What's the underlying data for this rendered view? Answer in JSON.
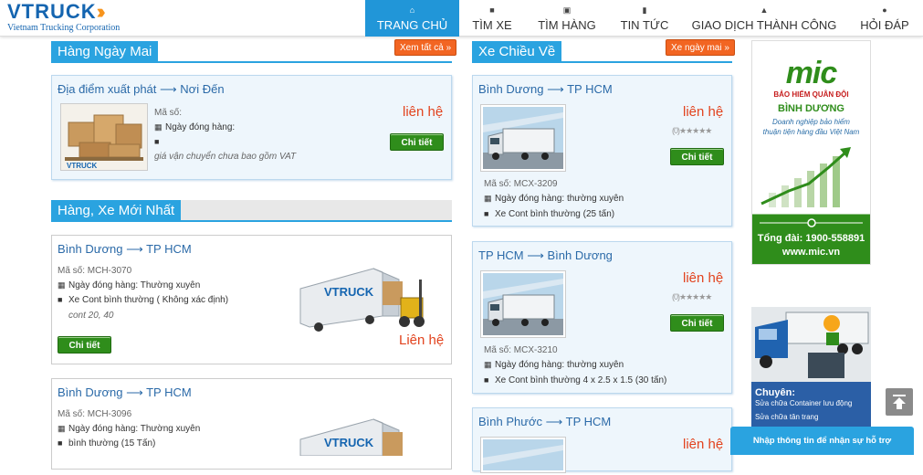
{
  "brand": {
    "word": "VTRUCK",
    "subtitle": "Vietnam Trucking Corporation"
  },
  "nav": [
    {
      "label": "TRANG CHỦ",
      "icon": "home-icon",
      "active": true
    },
    {
      "label": "TÌM XE",
      "icon": "truck-icon"
    },
    {
      "label": "TÌM HÀNG",
      "icon": "cubes-icon"
    },
    {
      "label": "TIN TỨC",
      "icon": "book-icon"
    },
    {
      "label": "GIAO DỊCH THÀNH CÔNG",
      "icon": "thumbs-up-icon"
    },
    {
      "label": "HỎI ĐÁP",
      "icon": "comments-icon"
    }
  ],
  "sections": {
    "tomorrow": {
      "title": "Hàng Ngày Mai",
      "more": "Xem tất cả »"
    },
    "return": {
      "title": "Xe Chiều Về",
      "more": "Xe ngày mai »"
    },
    "latest": {
      "title": "Hàng, Xe Mới Nhất"
    }
  },
  "tomorrow_card": {
    "route_from": "Địa điểm xuất phát",
    "route_to": "Nơi Đến",
    "code_label": "Mã số:",
    "date_label": "Ngày đóng hàng:",
    "note": "giá vận chuyển chưa bao gồm VAT",
    "price": "liên hệ",
    "button": "Chi tiết"
  },
  "latest_cards": [
    {
      "from": "Bình Dương",
      "to": "TP HCM",
      "code": "Mã số: MCH-3070",
      "date": "Ngày đóng hàng: Thường xuyên",
      "vehicle": "Xe Cont bình thường ( Không xác định)",
      "note": "cont 20, 40",
      "price": "Liên hệ",
      "button": "Chi tiết"
    },
    {
      "from": "Bình Dương",
      "to": "TP HCM",
      "code": "Mã số: MCH-3096",
      "date": "Ngày đóng hàng: Thường xuyên",
      "vehicle": "bình thường (15 Tấn)"
    }
  ],
  "return_cards": [
    {
      "from": "Bình Dương",
      "to": "TP HCM",
      "price": "liên hệ",
      "rating": "(0)★★★★★",
      "button": "Chi tiết",
      "code": "Mã số: MCX-3209",
      "date": "Ngày đóng hàng: thường xuyên",
      "vehicle": "Xe Cont bình thường (25 tấn)"
    },
    {
      "from": "TP HCM",
      "to": "Bình Dương",
      "price": "liên hệ",
      "rating": "(0)★★★★★",
      "button": "Chi tiết",
      "code": "Mã số: MCX-3210",
      "date": "Ngày đóng hàng: thường xuyên",
      "vehicle": "Xe Cont bình thường 4 x 2.5 x 1.5 (30 tấn)"
    },
    {
      "from": "Bình Phước",
      "to": "TP HCM",
      "price": "liên hệ"
    }
  ],
  "ads": {
    "mic": {
      "logo": "mic",
      "line1": "BẢO HIỂM QUÂN ĐỘI",
      "line2": "BÌNH DƯƠNG",
      "line3": "Doanh nghiệp bảo hiểm",
      "line4": "thuận tiện hàng đầu Việt Nam",
      "hotline": "Tổng đài: 1900-558891",
      "site": "www.mic.vn"
    },
    "repair": {
      "title": "Chuyên:",
      "line1": "Sửa chữa Container lưu động",
      "line2": "Sửa chữa tân trang"
    }
  },
  "support_bar": "Nhập thông tin để nhận sự hỗ trợ",
  "colors": {
    "accent": "#2aa3e0",
    "orange": "#f26522",
    "green": "#2f8d1b",
    "price": "#e2431e"
  }
}
